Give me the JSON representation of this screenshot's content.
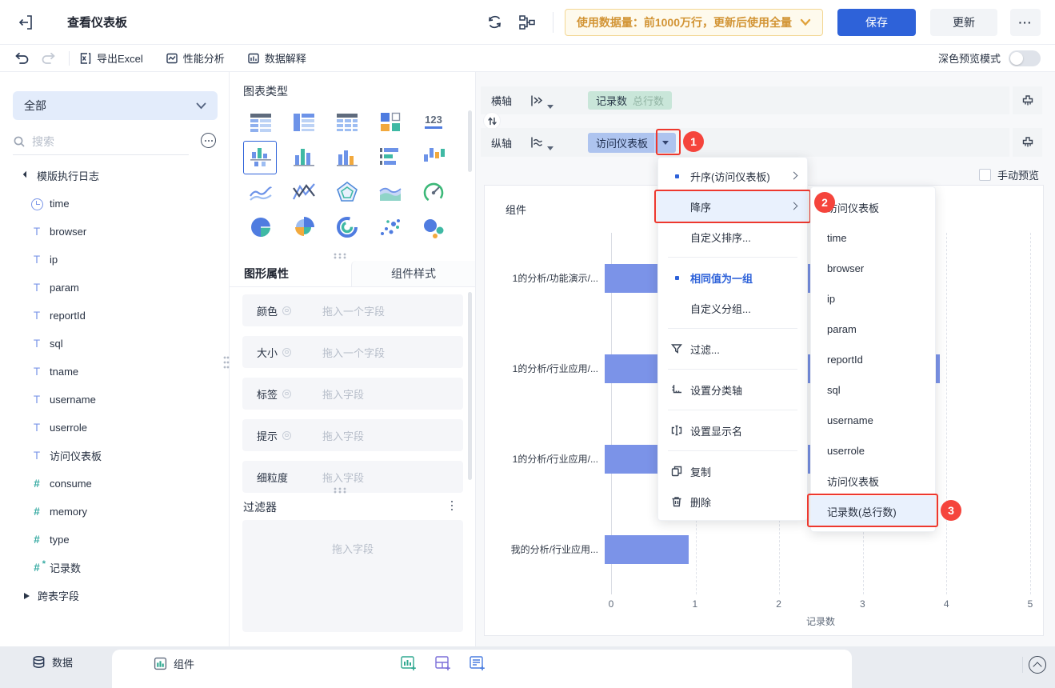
{
  "topbar": {
    "title": "查看仪表板",
    "data_banner": "使用数据量：前1000万行，更新后使用全量",
    "save": "保存",
    "update": "更新",
    "more": "···"
  },
  "toolbar": {
    "export_excel": "导出Excel",
    "performance": "性能分析",
    "data_explain": "数据解释",
    "dark_preview": "深色预览模式"
  },
  "sidebar": {
    "scope_selector": "全部",
    "search_placeholder": "搜索",
    "tree": [
      {
        "rowclass": "t-group expanded",
        "icon": "",
        "label": "模版执行日志"
      },
      {
        "rowclass": "t-field",
        "icon": "fi-time",
        "label": "time"
      },
      {
        "rowclass": "t-field",
        "icon": "fi-text",
        "label": "browser"
      },
      {
        "rowclass": "t-field",
        "icon": "fi-text",
        "label": "ip"
      },
      {
        "rowclass": "t-field",
        "icon": "fi-text",
        "label": "param"
      },
      {
        "rowclass": "t-field",
        "icon": "fi-text",
        "label": "reportId"
      },
      {
        "rowclass": "t-field",
        "icon": "fi-text",
        "label": "sql"
      },
      {
        "rowclass": "t-field",
        "icon": "fi-text",
        "label": "tname"
      },
      {
        "rowclass": "t-field",
        "icon": "fi-text",
        "label": "username"
      },
      {
        "rowclass": "t-field",
        "icon": "fi-text",
        "label": "userrole"
      },
      {
        "rowclass": "t-field",
        "icon": "fi-text",
        "label": "访问仪表板"
      },
      {
        "rowclass": "t-field",
        "icon": "fi-num",
        "label": "consume"
      },
      {
        "rowclass": "t-field",
        "icon": "fi-num",
        "label": "memory"
      },
      {
        "rowclass": "t-field",
        "icon": "fi-num",
        "label": "type"
      },
      {
        "rowclass": "t-field",
        "icon": "fi-numstar",
        "label": "记录数"
      },
      {
        "rowclass": "t-group collapsed",
        "icon": "",
        "label": "跨表字段"
      }
    ]
  },
  "chart_panel": {
    "title": "图表类型",
    "selected_icon": "stacked-column",
    "icon_names": [
      "group-table",
      "cross-table",
      "detail-table",
      "kpi-card",
      "kpi-number",
      "stacked-column",
      "column",
      "column-multi",
      "bar-horizontal",
      "range-column",
      "line",
      "multi-line",
      "radar",
      "area",
      "gauge",
      "pie",
      "rose-pie",
      "donut",
      "scatter",
      "bubble"
    ],
    "tab_active": "图形属性",
    "tab_inactive": "组件样式",
    "properties": [
      {
        "label": "颜色",
        "gearclass": "on",
        "placeholder": "拖入一个字段"
      },
      {
        "label": "大小",
        "gearclass": "on",
        "placeholder": "拖入一个字段"
      },
      {
        "label": "标签",
        "gearclass": "on",
        "placeholder": "拖入字段"
      },
      {
        "label": "提示",
        "gearclass": "on",
        "placeholder": "拖入字段"
      },
      {
        "label": "细粒度",
        "gearclass": "off",
        "placeholder": "拖入字段"
      }
    ],
    "filter_title": "过滤器",
    "filter_placeholder": "拖入字段"
  },
  "shelf": {
    "row_axis_label": "横轴",
    "row_pill_name": "记录数",
    "row_pill_agg": "总行数",
    "col_axis_label": "纵轴",
    "col_pill_name": "访问仪表板",
    "manual_preview": "手动预览"
  },
  "sort_menu": {
    "asc": "升序(访问仪表板)",
    "desc": "降序",
    "custom_sort": "自定义排序...",
    "group_same": "相同值为一组",
    "custom_group": "自定义分组...",
    "filter": "过滤...",
    "set_category_axis": "设置分类轴",
    "set_display_name": "设置显示名",
    "copy": "复制",
    "delete": "删除"
  },
  "field_submenu": {
    "items": [
      "访问仪表板",
      "time",
      "browser",
      "ip",
      "param",
      "reportId",
      "sql",
      "username",
      "userrole",
      "访问仪表板",
      "记录数(总行数)"
    ],
    "highlighted": "记录数(总行数)"
  },
  "annotations": {
    "step1": "1",
    "step2": "2",
    "step3": "3"
  },
  "chart_data": {
    "type": "bar",
    "orientation": "horizontal",
    "title": "组件",
    "categories": [
      "1的分析/功能演示/...",
      "1的分析/行业应用/...",
      "1的分析/行业应用/...",
      "我的分析/行业应用..."
    ],
    "values": [
      3.5,
      4,
      3,
      1
    ],
    "xticks": [
      0,
      1,
      2,
      3,
      4,
      5
    ],
    "xlim": [
      0,
      5
    ],
    "xlabel": "记录数",
    "bar_color": "#7b93e8",
    "grid": "dashed-vertical"
  },
  "bottombar": {
    "data_tab": "数据",
    "component_tab": "组件"
  },
  "colors": {
    "primary": "#2e62d9",
    "bar": "#7b93e8",
    "badge_red": "#f5443c",
    "warning_text": "#d29435",
    "pill_measure_bg": "#c9e6d9",
    "pill_dimension_bg": "#aec4ef",
    "menu_highlight": "#e9f1fd"
  }
}
